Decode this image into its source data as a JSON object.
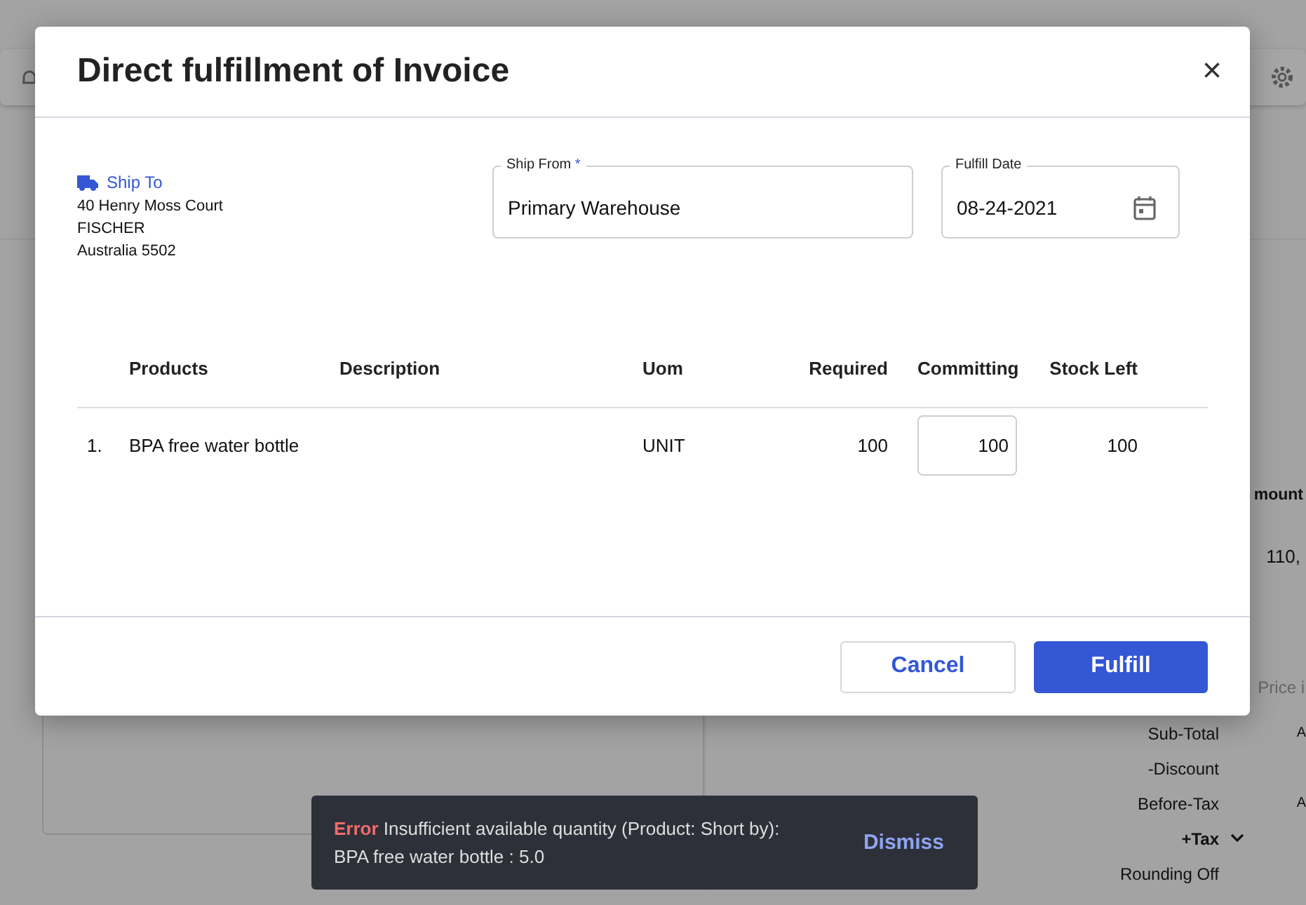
{
  "background": {
    "table_header": "mount",
    "table_value": "110,",
    "price_note": "Price i",
    "summary": [
      {
        "label": "Sub-Total",
        "value": "A"
      },
      {
        "label": "-Discount"
      },
      {
        "label": "Before-Tax",
        "value": "A"
      },
      {
        "label": "+Tax",
        "expandable": true
      },
      {
        "label": "Rounding Off"
      }
    ]
  },
  "dialog": {
    "title": "Direct fulfillment of Invoice",
    "close": "×",
    "ship_to": {
      "label": "Ship To",
      "lines": [
        "40 Henry Moss Court",
        "FISCHER",
        "Australia 5502"
      ]
    },
    "ship_from": {
      "label": "Ship From",
      "required_mark": "*",
      "value": "Primary Warehouse"
    },
    "fulfill_date": {
      "label": "Fulfill Date",
      "value": "08-24-2021"
    },
    "table": {
      "columns": [
        "",
        "Products",
        "Description",
        "Uom",
        "Required",
        "Committing",
        "Stock Left"
      ],
      "rows": [
        {
          "index": "1.",
          "product": "BPA free water bottle",
          "uom": "UNIT",
          "required": "100",
          "committing": "100",
          "stock_left": "100"
        }
      ]
    },
    "buttons": [
      {
        "label": "Cancel",
        "kind": "secondary"
      },
      {
        "label": "Fulfill",
        "kind": "primary"
      }
    ]
  },
  "toast": {
    "title": "Error",
    "message": "Insufficient available quantity (Product: Short by): BPA free water bottle : 5.0",
    "action": "Dismiss"
  }
}
